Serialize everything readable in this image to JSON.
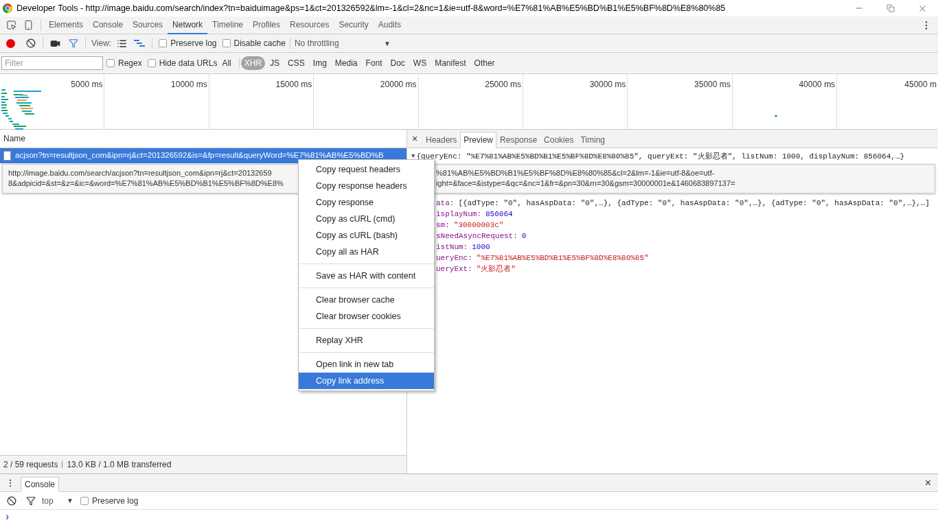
{
  "window": {
    "title": "Developer Tools - http://image.baidu.com/search/index?tn=baiduimage&ps=1&ct=201326592&lm=-1&cl=2&nc=1&ie=utf-8&word=%E7%81%AB%E5%BD%B1%E5%BF%8D%E8%80%85"
  },
  "panel_tabs": [
    {
      "label": "Elements",
      "selected": false
    },
    {
      "label": "Console",
      "selected": false
    },
    {
      "label": "Sources",
      "selected": false
    },
    {
      "label": "Network",
      "selected": true
    },
    {
      "label": "Timeline",
      "selected": false
    },
    {
      "label": "Profiles",
      "selected": false
    },
    {
      "label": "Resources",
      "selected": false
    },
    {
      "label": "Security",
      "selected": false
    },
    {
      "label": "Audits",
      "selected": false
    }
  ],
  "toolbar": {
    "recording": true,
    "filter_on": true,
    "view_label": "View:",
    "large_rows_on": false,
    "overview_on": true,
    "preserve_log": {
      "label": "Preserve log",
      "checked": false
    },
    "disable_cache": {
      "label": "Disable cache",
      "checked": false
    },
    "throttling": {
      "value": "No throttling",
      "arrow": "▼"
    }
  },
  "filter_bar": {
    "placeholder": "Filter",
    "regex": {
      "label": "Regex",
      "checked": false
    },
    "hide_data_urls": {
      "label": "Hide data URLs",
      "checked": false
    },
    "types": [
      {
        "label": "All",
        "selected": false
      },
      {
        "label": "XHR",
        "selected": true
      },
      {
        "label": "JS",
        "selected": false
      },
      {
        "label": "CSS",
        "selected": false
      },
      {
        "label": "Img",
        "selected": false
      },
      {
        "label": "Media",
        "selected": false
      },
      {
        "label": "Font",
        "selected": false
      },
      {
        "label": "Doc",
        "selected": false
      },
      {
        "label": "WS",
        "selected": false
      },
      {
        "label": "Manifest",
        "selected": false
      },
      {
        "label": "Other",
        "selected": false
      }
    ]
  },
  "overview": {
    "ticks": [
      "5000 ms",
      "10000 ms",
      "15000 ms",
      "20000 ms",
      "25000 ms",
      "30000 ms",
      "35000 ms",
      "40000 ms",
      "45000 m"
    ]
  },
  "requests": {
    "column": "Name",
    "rows": [
      {
        "name": "acjson?tn=resultjson_com&ipn=rj&ct=201326592&is=&fp=result&queryWord=%E7%81%AB%E5%BD%B",
        "selected": true
      }
    ]
  },
  "tooltip": {
    "left_lines": [
      "http://image.baidu.com/search/acjson?tn=resultjson_com&ipn=rj&ct=20132659",
      "8&adpicid=&st=&z=&ic=&word=%E7%81%AB%E5%BD%B1%E5%BF%8D%E8%"
    ],
    "right_lines": [
      "%81%AB%E5%BD%B1%E5%BF%8D%E8%80%85&cl=2&lm=-1&ie=utf-8&oe=utf-",
      "ight=&face=&istype=&qc=&nc=1&fr=&pn=30&rn=30&gsm=30000001e&1460683897137="
    ]
  },
  "status_bar": {
    "requests": "2 / 59 requests",
    "transferred": "13.0 KB / 1.0 MB transferred"
  },
  "detail": {
    "close": "×",
    "tabs": [
      {
        "label": "Headers",
        "selected": false
      },
      {
        "label": "Preview",
        "selected": true
      },
      {
        "label": "Response",
        "selected": false
      },
      {
        "label": "Cookies",
        "selected": false
      },
      {
        "label": "Timing",
        "selected": false
      }
    ],
    "summary": {
      "arrow": "▼",
      "text": "{queryEnc: \"%E7%81%AB%E5%BD%B1%E5%BF%8D%E8%80%85\", queryExt: \"火影忍者\", listNum: 1000, displayNum: 856064,…}"
    },
    "rows": [
      {
        "key": "ata:",
        "value": "[{adType: \"0\", hasAspData: \"0\",…}, {adType: \"0\", hasAspData: \"0\",…}, {adType: \"0\", hasAspData: \"0\",…},…]",
        "kind": "array"
      },
      {
        "key": "isplayNum:",
        "value": "856064",
        "kind": "number"
      },
      {
        "key": "sm:",
        "value": "\"30000003c\"",
        "kind": "string"
      },
      {
        "key": "sNeedAsyncRequest:",
        "value": "0",
        "kind": "number"
      },
      {
        "key": "istNum:",
        "value": "1000",
        "kind": "number"
      },
      {
        "key": "ueryEnc:",
        "value": "\"%E7%81%AB%E5%BD%B1%E5%BF%8D%E8%80%85\"",
        "kind": "string"
      },
      {
        "key": "ueryExt:",
        "value": "\"火影忍者\"",
        "kind": "string"
      }
    ]
  },
  "context_menu": {
    "groups": [
      [
        {
          "label": "Copy request headers",
          "selected": false
        },
        {
          "label": "Copy response headers",
          "selected": false
        },
        {
          "label": "Copy response",
          "selected": false
        },
        {
          "label": "Copy as cURL (cmd)",
          "selected": false
        },
        {
          "label": "Copy as cURL (bash)",
          "selected": false
        },
        {
          "label": "Copy all as HAR",
          "selected": false
        }
      ],
      [
        {
          "label": "Save as HAR with content",
          "selected": false
        }
      ],
      [
        {
          "label": "Clear browser cache",
          "selected": false
        },
        {
          "label": "Clear browser cookies",
          "selected": false
        }
      ],
      [
        {
          "label": "Replay XHR",
          "selected": false
        }
      ],
      [
        {
          "label": "Open link in new tab",
          "selected": false
        },
        {
          "label": "Copy link address",
          "selected": true
        }
      ]
    ]
  },
  "drawer": {
    "tab": "Console",
    "close": "×",
    "context": "top",
    "context_arrow": "▼",
    "preserve_log": {
      "label": "Preserve log",
      "checked": false
    },
    "prompt": "›"
  }
}
